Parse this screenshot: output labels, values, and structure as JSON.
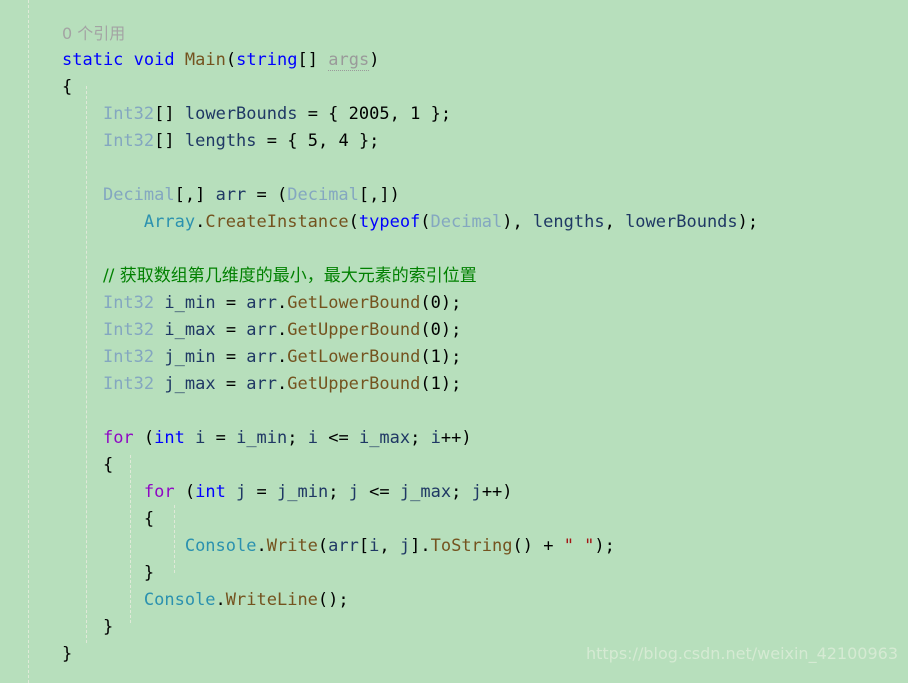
{
  "editor": {
    "background_color": "#b7dfbc",
    "codelens": "0 个引用",
    "watermark": "https://blog.csdn.net/weixin_42100963",
    "colors": {
      "keyword": "#0000ff",
      "control_keyword": "#8f08c4",
      "type": "#84a7c0",
      "identifier": "#1f3864",
      "method": "#74531f",
      "class": "#2b91af",
      "punctuation": "#000000",
      "string": "#a31515",
      "comment": "#008000",
      "unused_parameter": "#9a9a9a",
      "codelens": "#a3a3a3",
      "watermark": "#d5ead3",
      "indent_guide": "#dfe9d8"
    },
    "lines": {
      "l01_static": "static",
      "l01_void": "void",
      "l01_main": "Main",
      "l01_paren_open": "(",
      "l01_string": "string",
      "l01_brackets": "[]",
      "l01_args": "args",
      "l01_paren_close": ")",
      "l02_brace": "{",
      "l03_type": "Int32",
      "l03_brackets": "[]",
      "l03_name": "lowerBounds",
      "l03_rest": " = { ",
      "l03_v1": "2005",
      "l03_comma": ", ",
      "l03_v2": "1",
      "l03_end": " };",
      "l04_type": "Int32",
      "l04_brackets": "[]",
      "l04_name": "lengths",
      "l04_rest": " = { ",
      "l04_v1": "5",
      "l04_comma": ", ",
      "l04_v2": "4",
      "l04_end": " };",
      "l06_type": "Decimal",
      "l06_brackets": "[,]",
      "l06_name": "arr",
      "l06_eq": " = (",
      "l06_cast_type": "Decimal",
      "l06_cast_brackets": "[,])",
      "l07_class": "Array",
      "l07_dot": ".",
      "l07_method": "CreateInstance",
      "l07_paren": "(",
      "l07_typeof": "typeof",
      "l07_paren2": "(",
      "l07_type": "Decimal",
      "l07_paren3": "), ",
      "l07_arg1": "lengths",
      "l07_comma": ", ",
      "l07_arg2": "lowerBounds",
      "l07_end": ");",
      "l09_comment": "// 获取数组第几维度的最小，最大元素的索引位置",
      "l10_type": "Int32",
      "l10_name": "i_min",
      "l10_eq": " = ",
      "l10_obj": "arr",
      "l10_dot": ".",
      "l10_method": "GetLowerBound",
      "l10_call": "(",
      "l10_arg": "0",
      "l10_end": ");",
      "l11_type": "Int32",
      "l11_name": "i_max",
      "l11_eq": " = ",
      "l11_obj": "arr",
      "l11_dot": ".",
      "l11_method": "GetUpperBound",
      "l11_call": "(",
      "l11_arg": "0",
      "l11_end": ");",
      "l12_type": "Int32",
      "l12_name": "j_min",
      "l12_eq": " = ",
      "l12_obj": "arr",
      "l12_dot": ".",
      "l12_method": "GetLowerBound",
      "l12_call": "(",
      "l12_arg": "1",
      "l12_end": ");",
      "l13_type": "Int32",
      "l13_name": "j_max",
      "l13_eq": " = ",
      "l13_obj": "arr",
      "l13_dot": ".",
      "l13_method": "GetUpperBound",
      "l13_call": "(",
      "l13_arg": "1",
      "l13_end": ");",
      "l15_for": "for",
      "l15_open": " (",
      "l15_int": "int",
      "l15_var": " i",
      "l15_eq": " = ",
      "l15_init": "i_min",
      "l15_semi1": "; ",
      "l15_cond_a": "i",
      "l15_op": " <= ",
      "l15_cond_b": "i_max",
      "l15_semi2": "; ",
      "l15_inc": "i",
      "l15_plus": "++)",
      "l16_brace": "{",
      "l17_for": "for",
      "l17_open": " (",
      "l17_int": "int",
      "l17_var": " j",
      "l17_eq": " = ",
      "l17_init": "j_min",
      "l17_semi1": "; ",
      "l17_cond_a": "j",
      "l17_op": " <= ",
      "l17_cond_b": "j_max",
      "l17_semi2": "; ",
      "l17_inc": "j",
      "l17_plus": "++)",
      "l18_brace": "{",
      "l19_class": "Console",
      "l19_dot": ".",
      "l19_method": "Write",
      "l19_open": "(",
      "l19_arr": "arr",
      "l19_idx_open": "[",
      "l19_i": "i",
      "l19_idx_comma": ", ",
      "l19_j": "j",
      "l19_idx_close": "].",
      "l19_tostring": "ToString",
      "l19_call": "() + ",
      "l19_str": "\" \"",
      "l19_end": ");",
      "l20_brace": "}",
      "l21_class": "Console",
      "l21_dot": ".",
      "l21_method": "WriteLine",
      "l21_end": "();",
      "l22_brace": "}",
      "l23_brace": "}"
    }
  }
}
